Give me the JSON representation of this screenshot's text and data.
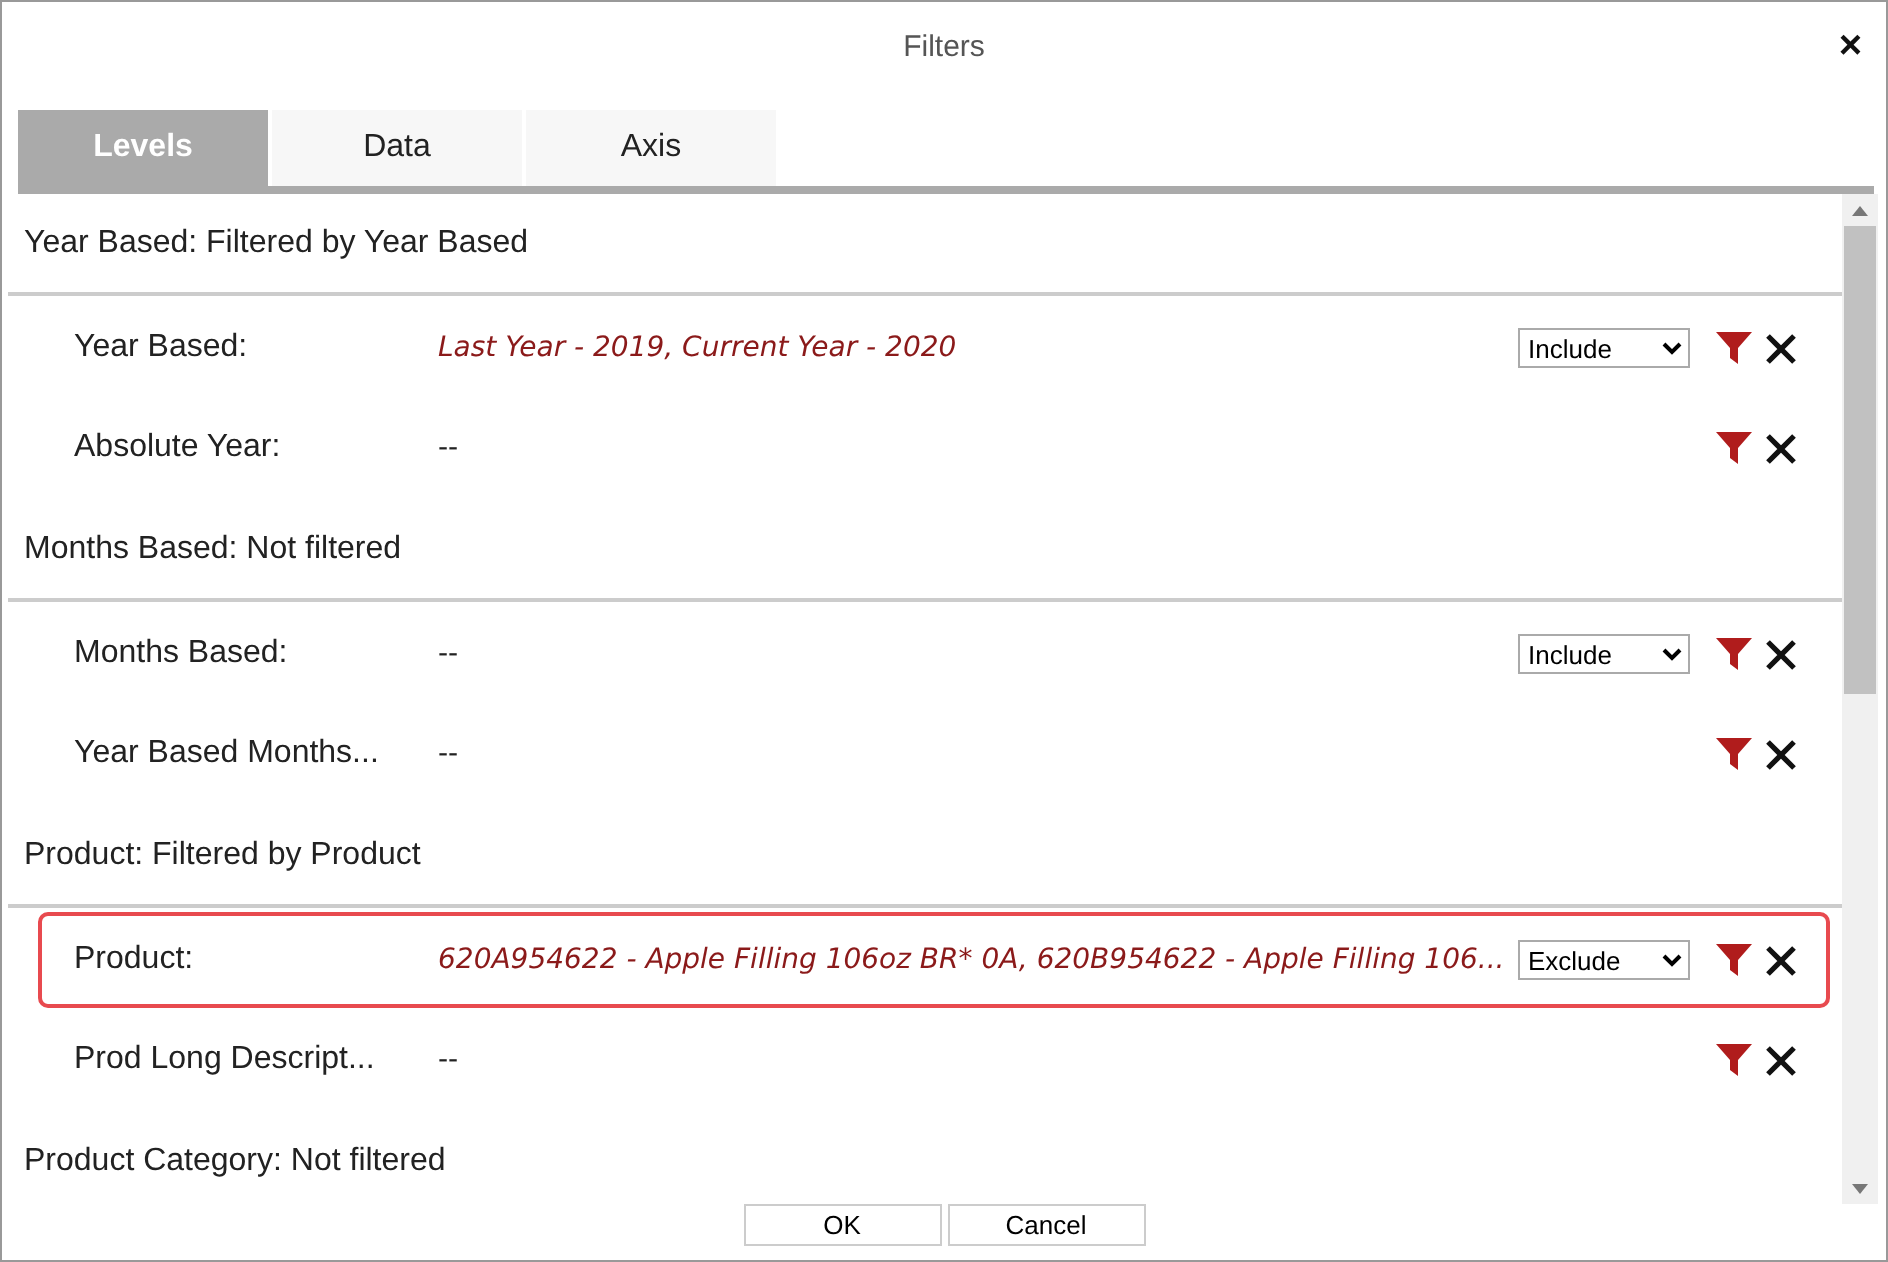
{
  "window": {
    "title": "Filters",
    "close": "×"
  },
  "tabs": [
    {
      "label": "Levels",
      "selected": true
    },
    {
      "label": "Data",
      "selected": false
    },
    {
      "label": "Axis",
      "selected": false
    }
  ],
  "groups": [
    {
      "heading": "Year Based: Filtered by Year Based",
      "rows": [
        {
          "label": "Year Based:",
          "value": "Last Year - 2019, Current Year - 2020",
          "filtered": true,
          "mode": "Include",
          "highlighted": false
        },
        {
          "label": "Absolute Year:",
          "value": "--",
          "filtered": false,
          "highlighted": false
        }
      ]
    },
    {
      "heading": "Months Based: Not filtered",
      "rows": [
        {
          "label": "Months Based:",
          "value": "--",
          "filtered": false,
          "mode": "Include",
          "highlighted": false
        },
        {
          "label": "Year Based Months...",
          "value": "--",
          "filtered": false,
          "highlighted": false
        }
      ]
    },
    {
      "heading": "Product: Filtered by Product",
      "rows": [
        {
          "label": "Product:",
          "value": "620A954622 - Apple Filling 106oz BR* 0A, 620B954622 - Apple Filling 106...",
          "filtered": true,
          "mode": "Exclude",
          "highlighted": true
        },
        {
          "label": "Prod Long Descript...",
          "value": "--",
          "filtered": false,
          "highlighted": false
        }
      ]
    },
    {
      "heading": "Product Category: Not filtered"
    }
  ],
  "buttons": [
    "OK",
    "Cancel"
  ]
}
